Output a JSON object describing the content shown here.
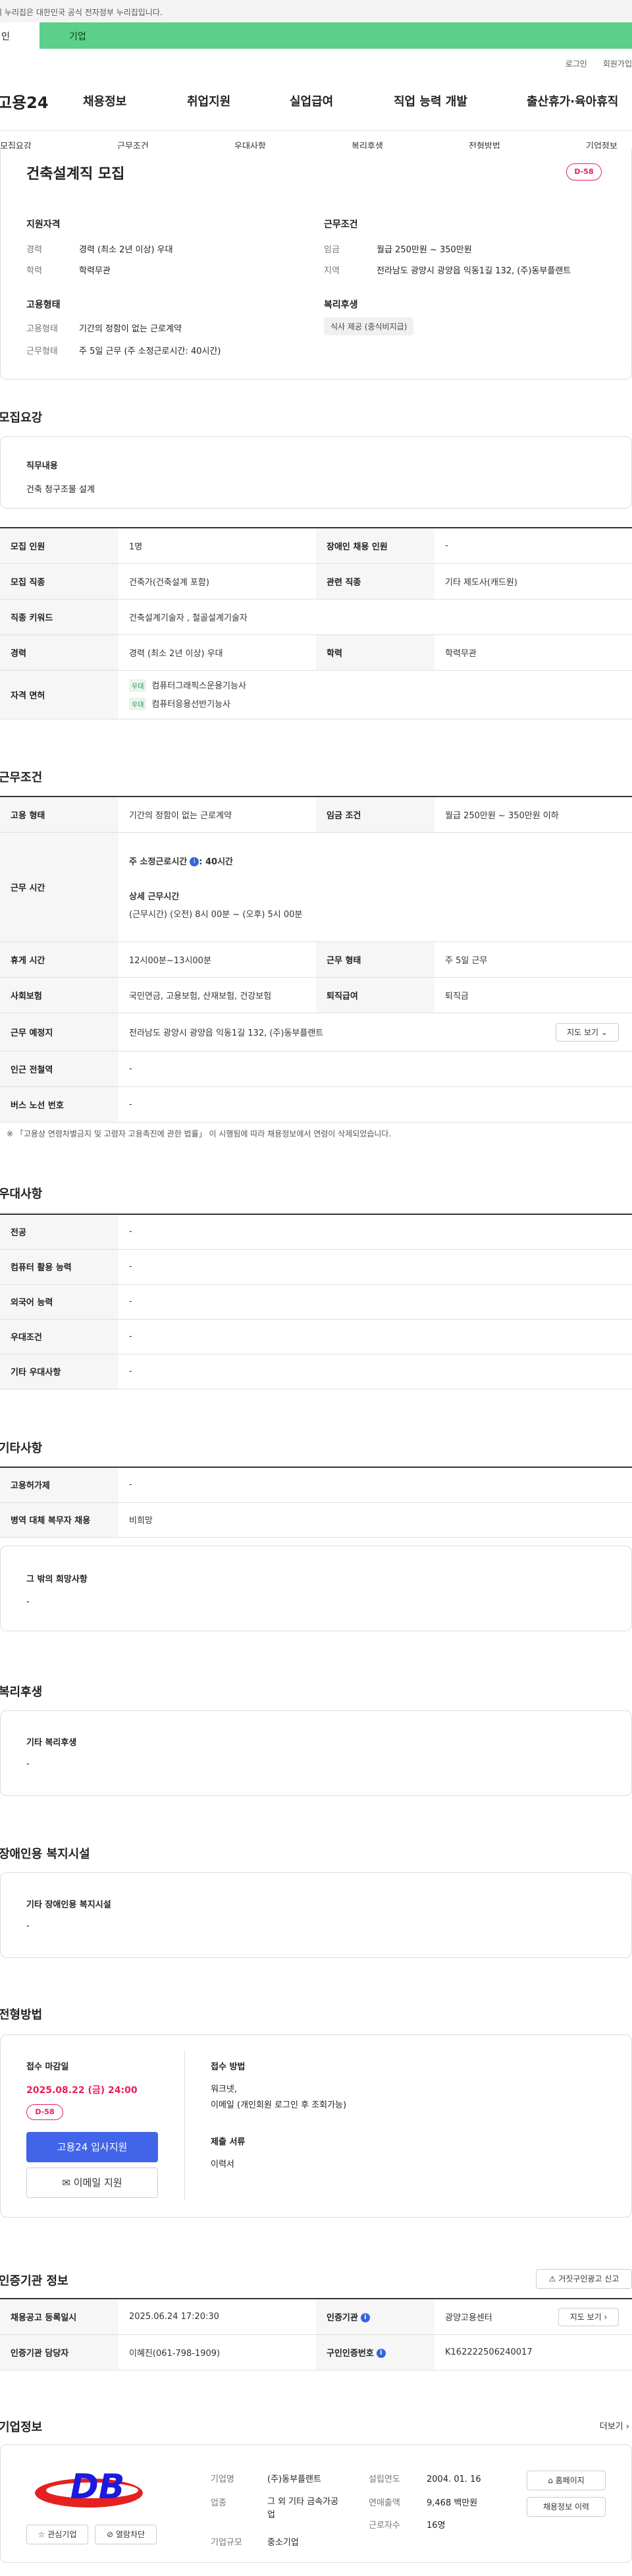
{
  "banner": {
    "text": "이 누리집은 대한민국 공식 전자정부 누리집입니다."
  },
  "switch": {
    "tab_a": "인",
    "tab_b": "기업"
  },
  "util": {
    "login": "로그인",
    "join": "회원가입"
  },
  "nav": {
    "logo": "고용24",
    "items": [
      "채용정보",
      "취업지원",
      "실업급여",
      "직업 능력 개발",
      "출산휴가·육아휴직"
    ]
  },
  "subnav": {
    "items": [
      "모집요강",
      "근무조건",
      "우대사항",
      "복리후생",
      "전형방법",
      "기업정보"
    ]
  },
  "summary": {
    "title": "건축설계직 모집",
    "dday": "D-58",
    "qual_head": "지원자격",
    "career_k": "경력",
    "career_v": "경력 (최소 2년 이상) 우대",
    "edu_k": "학력",
    "edu_v": "학력무관",
    "emp_head": "고용형태",
    "emptype_k": "고용형태",
    "emptype_v": "기간의 정함이 없는 근로계약",
    "worktype_k": "근무형태",
    "worktype_v": "주 5일 근무 (주 소정근로시간: 40시간)",
    "cond_head": "근무조건",
    "wage_k": "임금",
    "wage_v": "월급 250만원 ~ 350만원",
    "region_k": "지역",
    "region_v": "전라남도 광양시 광양읍 익동1길 132, (주)동부플랜트",
    "welfare_head": "복리후생",
    "welfare_pill": "식사 제공 (중식비지급)"
  },
  "recruit": {
    "section_title": "모집요강",
    "duty_label": "직무내용",
    "duty_text": "건축 청구조물 설계",
    "rows": {
      "count_k": "모집 인원",
      "count_v": "1명",
      "disab_k": "장애인 채용 인원",
      "disab_v": "-",
      "job_k": "모집 직종",
      "job_v": "건축가(건축설계 포함)",
      "rel_k": "관련 직종",
      "rel_v": "기타 제도사(캐드원)",
      "kw_k": "직종 키워드",
      "kw_v": "건축설계기술자 , 철골설계기술자",
      "career_k": "경력",
      "career_v": "경력 (최소 2년 이상) 우대",
      "edu_k": "학력",
      "edu_v": "학력무관",
      "license_k": "자격 면허",
      "license_badge": "우대",
      "license_1": "컴퓨터그래픽스운용기능사",
      "license_2": "컴퓨터응용선반기능사"
    }
  },
  "work": {
    "section_title": "근무조건",
    "emp_k": "고용 형태",
    "emp_v": "기간의 정함이 없는 근로계약",
    "wage_k": "임금 조건",
    "wage_v": "월급 250만원 ~ 350만원 이하",
    "time_k": "근무 시간",
    "time_week": "주 소정근로시간",
    "time_week_v": ": 40시간",
    "time_detail_label": "상세 근무시간",
    "time_detail": "(근무시간) (오전) 8시 00분 ~ (오후) 5시 00분",
    "rest_k": "휴게 시간",
    "rest_v": "12시00분~13시00분",
    "form_k": "근무 형태",
    "form_v": "주 5일 근무",
    "ins_k": "사회보험",
    "ins_v": "국민연금, 고용보험, 산재보험, 건강보험",
    "ret_k": "퇴직급여",
    "ret_v": "퇴직금",
    "place_k": "근무 예정지",
    "place_v": "전라남도 광양시 광양읍 익동1길 132, (주)동부플랜트",
    "map_btn": "지도 보기",
    "station_k": "인근 전철역",
    "station_v": "-",
    "bus_k": "버스 노선 번호",
    "bus_v": "-",
    "note": "※ 「고용상 연령차별금지 및 고령자 고용촉진에 관한 법률」 이 시행됨에 따라 채용정보에서 연령이 삭제되었습니다."
  },
  "pref": {
    "section_title": "우대사항",
    "rows": [
      {
        "k": "전공",
        "v": "-"
      },
      {
        "k": "컴퓨터 활용 능력",
        "v": "-"
      },
      {
        "k": "외국어 능력",
        "v": "-"
      },
      {
        "k": "우대조건",
        "v": "-"
      },
      {
        "k": "기타 우대사항",
        "v": "-"
      }
    ]
  },
  "etc": {
    "section_title": "기타사항",
    "rows": [
      {
        "k": "고용허가제",
        "v": "-"
      },
      {
        "k": "병역 대체 복무자 채용",
        "v": "비희망"
      }
    ],
    "other_label": "그 밖의 희망사항",
    "other_v": "-"
  },
  "welfare": {
    "section_title": "복리후생",
    "label": "기타 복리후생",
    "v": "-"
  },
  "disab_fac": {
    "section_title": "장애인용 복지시설",
    "label": "기타 장애인용 복지시설",
    "v": "-"
  },
  "apply": {
    "section_title": "전형방법",
    "deadline_label": "접수 마감일",
    "deadline": "2025.08.22 (금) 24:00",
    "dday": "D-58",
    "apply_btn": "고용24 입사지원",
    "email_btn": "이메일 지원",
    "method_label": "접수 방법",
    "method_1": "워크넷,",
    "method_2": "이메일 (개인회원 로그인 후 조회가능)",
    "docs_label": "제출 서류",
    "docs_v": "이력서"
  },
  "cert": {
    "section_title": "인증기관 정보",
    "report_btn": "거짓구인광고 신고",
    "reg_k": "채용공고 등록일시",
    "reg_v": "2025.06.24 17:20:30",
    "org_k": "인증기관",
    "org_v": "광양고용센터",
    "map_btn": "지도 보기",
    "mgr_k": "인증기관 담당자",
    "mgr_v": "이혜진(061-798-1909)",
    "no_k": "구인인증번호",
    "no_v": "K162222506240017"
  },
  "company": {
    "section_title": "기업정보",
    "more": "더보기",
    "logo_text": "DB",
    "fav_btn": "관심기업",
    "block_btn": "열람차단",
    "name_k": "기업명",
    "name_v": "(주)동부플랜트",
    "ind_k": "업종",
    "ind_v": "그 외 기타 금속가공업",
    "size_k": "기업규모",
    "size_v": "중소기업",
    "year_k": "설립연도",
    "year_v": "2004. 01. 16",
    "sales_k": "연매출액",
    "sales_v": "9,468 백만원",
    "emp_k": "근로자수",
    "emp_v": "16명",
    "home_btn": "홈페이지",
    "history_btn": "채용정보 이력"
  }
}
